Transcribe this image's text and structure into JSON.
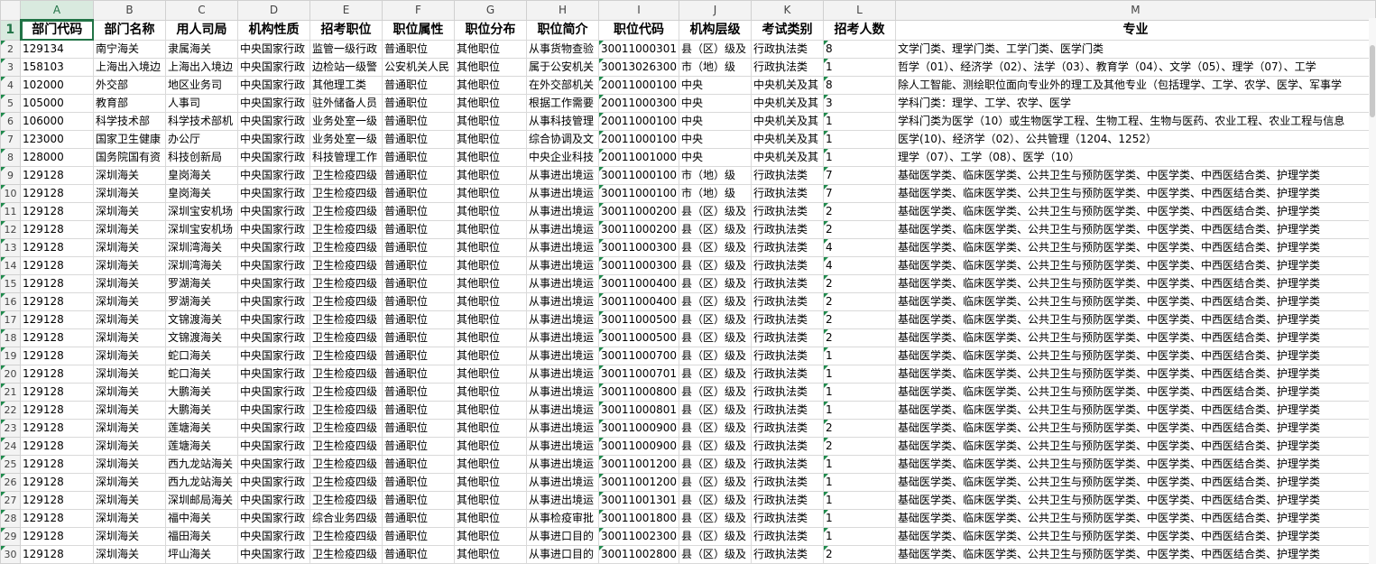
{
  "columns": [
    "A",
    "B",
    "C",
    "D",
    "E",
    "F",
    "G",
    "H",
    "I",
    "J",
    "K",
    "L",
    "M"
  ],
  "header": [
    "部门代码",
    "部门名称",
    "用人司局",
    "机构性质",
    "招考职位",
    "职位属性",
    "职位分布",
    "职位简介",
    "职位代码",
    "机构层级",
    "考试类别",
    "招考人数",
    "专业"
  ],
  "rows": [
    [
      "129134",
      "南宁海关",
      "隶属海关",
      "中央国家行政",
      "监管一级行政",
      "普通职位",
      "其他职位",
      "从事货物查验",
      "30011000301",
      "县（区）级及",
      "行政执法类",
      "8",
      "文学门类、理学门类、工学门类、医学门类"
    ],
    [
      "158103",
      "上海出入境边",
      "上海出入境边",
      "中央国家行政",
      "边检站一级警",
      "公安机关人民",
      "其他职位",
      "属于公安机关",
      "30013026300",
      "市（地）级",
      "行政执法类",
      "1",
      "哲学（01）、经济学（02）、法学（03）、教育学（04）、文学（05）、理学（07）、工学"
    ],
    [
      "102000",
      "外交部",
      "地区业务司",
      "中央国家行政",
      "其他理工类",
      "普通职位",
      "其他职位",
      "在外交部机关",
      "20011000100",
      "中央",
      "中央机关及其",
      "8",
      "除人工智能、测绘职位面向专业外的理工及其他专业（包括理学、工学、农学、医学、军事学"
    ],
    [
      "105000",
      "教育部",
      "人事司",
      "中央国家行政",
      "驻外储备人员",
      "普通职位",
      "其他职位",
      "根据工作需要",
      "20011000300",
      "中央",
      "中央机关及其",
      "3",
      "学科门类：理学、工学、农学、医学"
    ],
    [
      "106000",
      "科学技术部",
      "科学技术部机",
      "中央国家行政",
      "业务处室一级",
      "普通职位",
      "其他职位",
      "从事科技管理",
      "20011000100",
      "中央",
      "中央机关及其",
      "1",
      "学科门类为医学（10）或生物医学工程、生物工程、生物与医药、农业工程、农业工程与信息"
    ],
    [
      "123000",
      "国家卫生健康",
      "办公厅",
      "中央国家行政",
      "业务处室一级",
      "普通职位",
      "其他职位",
      "综合协调及文",
      "20011000100",
      "中央",
      "中央机关及其",
      "1",
      "医学(10)、经济学（02）、公共管理（1204、1252）"
    ],
    [
      "128000",
      "国务院国有资",
      "科技创新局",
      "中央国家行政",
      "科技管理工作",
      "普通职位",
      "其他职位",
      "中央企业科技",
      "20011001000",
      "中央",
      "中央机关及其",
      "1",
      "理学（07）、工学（08）、医学（10）"
    ],
    [
      "129128",
      "深圳海关",
      "皇岗海关",
      "中央国家行政",
      "卫生检疫四级",
      "普通职位",
      "其他职位",
      "从事进出境运",
      "30011000100",
      "市（地）级",
      "行政执法类",
      "7",
      "基础医学类、临床医学类、公共卫生与预防医学类、中医学类、中西医结合类、护理学类"
    ],
    [
      "129128",
      "深圳海关",
      "皇岗海关",
      "中央国家行政",
      "卫生检疫四级",
      "普通职位",
      "其他职位",
      "从事进出境运",
      "30011000100",
      "市（地）级",
      "行政执法类",
      "7",
      "基础医学类、临床医学类、公共卫生与预防医学类、中医学类、中西医结合类、护理学类"
    ],
    [
      "129128",
      "深圳海关",
      "深圳宝安机场",
      "中央国家行政",
      "卫生检疫四级",
      "普通职位",
      "其他职位",
      "从事进出境运",
      "30011000200",
      "县（区）级及",
      "行政执法类",
      "2",
      "基础医学类、临床医学类、公共卫生与预防医学类、中医学类、中西医结合类、护理学类"
    ],
    [
      "129128",
      "深圳海关",
      "深圳宝安机场",
      "中央国家行政",
      "卫生检疫四级",
      "普通职位",
      "其他职位",
      "从事进出境运",
      "30011000200",
      "县（区）级及",
      "行政执法类",
      "2",
      "基础医学类、临床医学类、公共卫生与预防医学类、中医学类、中西医结合类、护理学类"
    ],
    [
      "129128",
      "深圳海关",
      "深圳湾海关",
      "中央国家行政",
      "卫生检疫四级",
      "普通职位",
      "其他职位",
      "从事进出境运",
      "30011000300",
      "县（区）级及",
      "行政执法类",
      "4",
      "基础医学类、临床医学类、公共卫生与预防医学类、中医学类、中西医结合类、护理学类"
    ],
    [
      "129128",
      "深圳海关",
      "深圳湾海关",
      "中央国家行政",
      "卫生检疫四级",
      "普通职位",
      "其他职位",
      "从事进出境运",
      "30011000300",
      "县（区）级及",
      "行政执法类",
      "4",
      "基础医学类、临床医学类、公共卫生与预防医学类、中医学类、中西医结合类、护理学类"
    ],
    [
      "129128",
      "深圳海关",
      "罗湖海关",
      "中央国家行政",
      "卫生检疫四级",
      "普通职位",
      "其他职位",
      "从事进出境运",
      "30011000400",
      "县（区）级及",
      "行政执法类",
      "2",
      "基础医学类、临床医学类、公共卫生与预防医学类、中医学类、中西医结合类、护理学类"
    ],
    [
      "129128",
      "深圳海关",
      "罗湖海关",
      "中央国家行政",
      "卫生检疫四级",
      "普通职位",
      "其他职位",
      "从事进出境运",
      "30011000400",
      "县（区）级及",
      "行政执法类",
      "2",
      "基础医学类、临床医学类、公共卫生与预防医学类、中医学类、中西医结合类、护理学类"
    ],
    [
      "129128",
      "深圳海关",
      "文锦渡海关",
      "中央国家行政",
      "卫生检疫四级",
      "普通职位",
      "其他职位",
      "从事进出境运",
      "30011000500",
      "县（区）级及",
      "行政执法类",
      "2",
      "基础医学类、临床医学类、公共卫生与预防医学类、中医学类、中西医结合类、护理学类"
    ],
    [
      "129128",
      "深圳海关",
      "文锦渡海关",
      "中央国家行政",
      "卫生检疫四级",
      "普通职位",
      "其他职位",
      "从事进出境运",
      "30011000500",
      "县（区）级及",
      "行政执法类",
      "2",
      "基础医学类、临床医学类、公共卫生与预防医学类、中医学类、中西医结合类、护理学类"
    ],
    [
      "129128",
      "深圳海关",
      "蛇口海关",
      "中央国家行政",
      "卫生检疫四级",
      "普通职位",
      "其他职位",
      "从事进出境运",
      "30011000700",
      "县（区）级及",
      "行政执法类",
      "1",
      "基础医学类、临床医学类、公共卫生与预防医学类、中医学类、中西医结合类、护理学类"
    ],
    [
      "129128",
      "深圳海关",
      "蛇口海关",
      "中央国家行政",
      "卫生检疫四级",
      "普通职位",
      "其他职位",
      "从事进出境运",
      "30011000701",
      "县（区）级及",
      "行政执法类",
      "1",
      "基础医学类、临床医学类、公共卫生与预防医学类、中医学类、中西医结合类、护理学类"
    ],
    [
      "129128",
      "深圳海关",
      "大鹏海关",
      "中央国家行政",
      "卫生检疫四级",
      "普通职位",
      "其他职位",
      "从事进出境运",
      "30011000800",
      "县（区）级及",
      "行政执法类",
      "1",
      "基础医学类、临床医学类、公共卫生与预防医学类、中医学类、中西医结合类、护理学类"
    ],
    [
      "129128",
      "深圳海关",
      "大鹏海关",
      "中央国家行政",
      "卫生检疫四级",
      "普通职位",
      "其他职位",
      "从事进出境运",
      "30011000801",
      "县（区）级及",
      "行政执法类",
      "1",
      "基础医学类、临床医学类、公共卫生与预防医学类、中医学类、中西医结合类、护理学类"
    ],
    [
      "129128",
      "深圳海关",
      "莲塘海关",
      "中央国家行政",
      "卫生检疫四级",
      "普通职位",
      "其他职位",
      "从事进出境运",
      "30011000900",
      "县（区）级及",
      "行政执法类",
      "2",
      "基础医学类、临床医学类、公共卫生与预防医学类、中医学类、中西医结合类、护理学类"
    ],
    [
      "129128",
      "深圳海关",
      "莲塘海关",
      "中央国家行政",
      "卫生检疫四级",
      "普通职位",
      "其他职位",
      "从事进出境运",
      "30011000900",
      "县（区）级及",
      "行政执法类",
      "2",
      "基础医学类、临床医学类、公共卫生与预防医学类、中医学类、中西医结合类、护理学类"
    ],
    [
      "129128",
      "深圳海关",
      "西九龙站海关",
      "中央国家行政",
      "卫生检疫四级",
      "普通职位",
      "其他职位",
      "从事进出境运",
      "30011001200",
      "县（区）级及",
      "行政执法类",
      "1",
      "基础医学类、临床医学类、公共卫生与预防医学类、中医学类、中西医结合类、护理学类"
    ],
    [
      "129128",
      "深圳海关",
      "西九龙站海关",
      "中央国家行政",
      "卫生检疫四级",
      "普通职位",
      "其他职位",
      "从事进出境运",
      "30011001200",
      "县（区）级及",
      "行政执法类",
      "1",
      "基础医学类、临床医学类、公共卫生与预防医学类、中医学类、中西医结合类、护理学类"
    ],
    [
      "129128",
      "深圳海关",
      "深圳邮局海关",
      "中央国家行政",
      "卫生检疫四级",
      "普通职位",
      "其他职位",
      "从事进出境运",
      "30011001301",
      "县（区）级及",
      "行政执法类",
      "1",
      "基础医学类、临床医学类、公共卫生与预防医学类、中医学类、中西医结合类、护理学类"
    ],
    [
      "129128",
      "深圳海关",
      "福中海关",
      "中央国家行政",
      "综合业务四级",
      "普通职位",
      "其他职位",
      "从事检疫审批",
      "30011001800",
      "县（区）级及",
      "行政执法类",
      "1",
      "基础医学类、临床医学类、公共卫生与预防医学类、中医学类、中西医结合类、护理学类"
    ],
    [
      "129128",
      "深圳海关",
      "福田海关",
      "中央国家行政",
      "卫生检疫四级",
      "普通职位",
      "其他职位",
      "从事进口目的",
      "30011002300",
      "县（区）级及",
      "行政执法类",
      "1",
      "基础医学类、临床医学类、公共卫生与预防医学类、中医学类、中西医结合类、护理学类"
    ],
    [
      "129128",
      "深圳海关",
      "坪山海关",
      "中央国家行政",
      "卫生检疫四级",
      "普通职位",
      "其他职位",
      "从事进口目的",
      "30011002800",
      "县（区）级及",
      "行政执法类",
      "2",
      "基础医学类、临床医学类、公共卫生与预防医学类、中医学类、中西医结合类、护理学类"
    ]
  ],
  "colors": {
    "accent": "#217346",
    "header_bg": "#f3f3f3",
    "grid": "#d9d9d9",
    "warn_triangle": "#1f8a4c"
  }
}
